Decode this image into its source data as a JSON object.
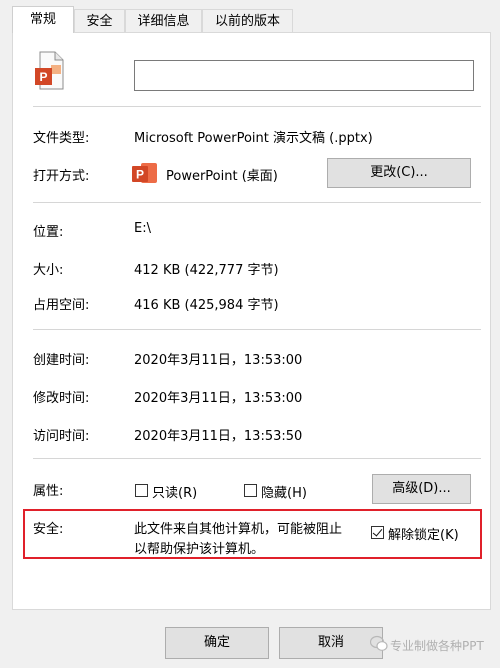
{
  "tabs": [
    "常规",
    "安全",
    "详细信息",
    "以前的版本"
  ],
  "file": {
    "name": ""
  },
  "fields": {
    "type_label": "文件类型:",
    "type_value": "Microsoft PowerPoint 演示文稿 (.pptx)",
    "open_label": "打开方式:",
    "open_app": "PowerPoint (桌面)",
    "change_button": "更改(C)...",
    "location_label": "位置:",
    "location_value": "E:\\",
    "size_label": "大小:",
    "size_value": "412 KB (422,777 字节)",
    "disk_label": "占用空间:",
    "disk_value": "416 KB (425,984 字节)",
    "created_label": "创建时间:",
    "created_value": "2020年3月11日，13:53:00",
    "modified_label": "修改时间:",
    "modified_value": "2020年3月11日，13:53:00",
    "accessed_label": "访问时间:",
    "accessed_value": "2020年3月11日，13:53:50",
    "attr_label": "属性:",
    "readonly_label": "只读(R)",
    "hidden_label": "隐藏(H)",
    "advanced_button": "高级(D)..."
  },
  "security": {
    "label": "安全:",
    "line1": "此文件来自其他计算机，可能被阻止",
    "line2": "以帮助保护该计算机。",
    "unblock_label": "解除锁定(K)",
    "unblock_checked": true
  },
  "buttons": {
    "ok": "确定",
    "cancel": "取消"
  },
  "watermark": "专业制做各种PPT",
  "colors": {
    "ppt_orange": "#d24726",
    "highlight_red": "#e0202a"
  },
  "icons": {
    "file": "powerpoint-file-icon",
    "app": "powerpoint-app-icon"
  }
}
